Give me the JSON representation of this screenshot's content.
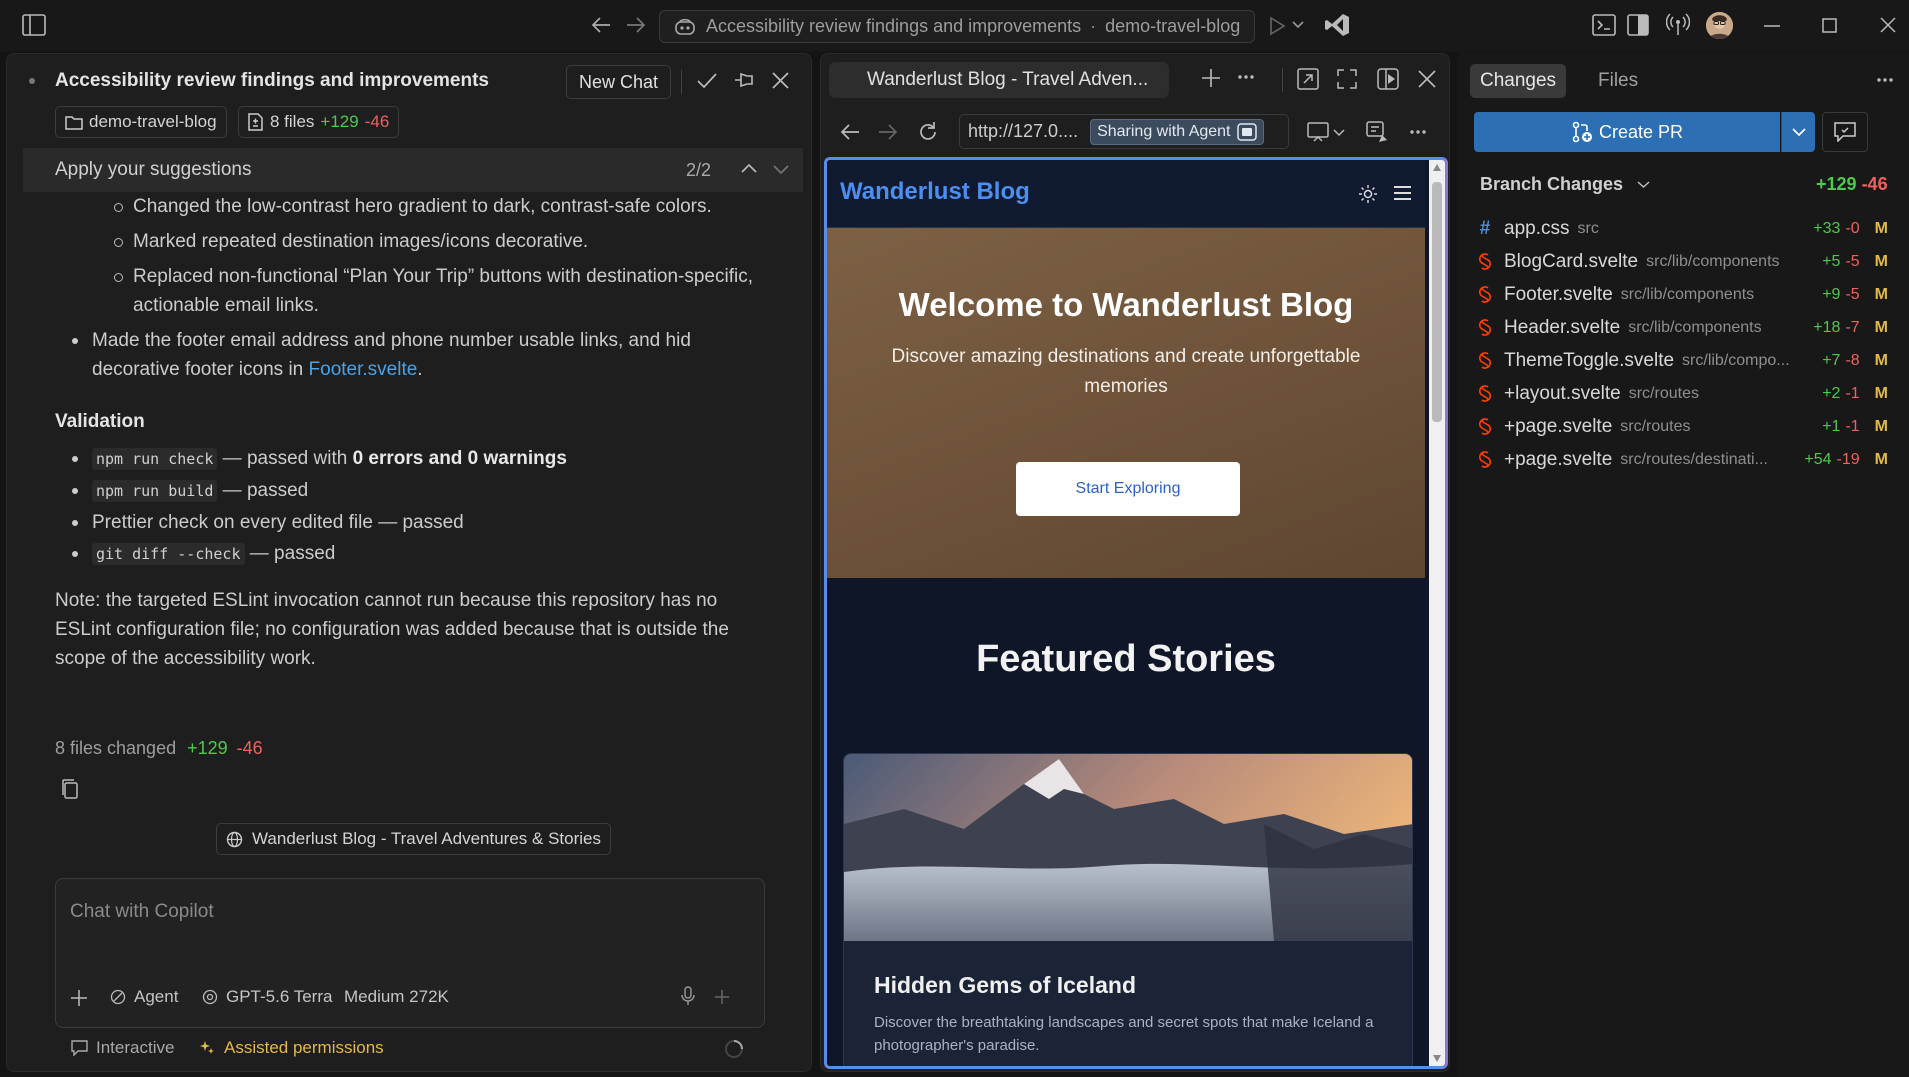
{
  "titlebar": {
    "command_center": {
      "title": "Accessibility review findings and improvements",
      "separator": "·",
      "repo": "demo-travel-blog"
    }
  },
  "chat": {
    "title": "Accessibility review findings and improvements",
    "new_chat_label": "New Chat",
    "repo_chip": "demo-travel-blog",
    "files_chip": {
      "label": "8 files",
      "added": "+129",
      "removed": "-46"
    },
    "suggestions": {
      "label": "Apply your suggestions",
      "counter": "2/2"
    },
    "message": {
      "sub_bullets": [
        "Changed the low-contrast hero gradient to dark, contrast-safe colors.",
        "Marked repeated destination images/icons decorative.",
        "Replaced non-functional “Plan Your Trip” buttons with destination-specific, actionable email links."
      ],
      "footer_bullet": {
        "text": "Made the footer email address and phone number usable links, and hid decorative footer icons in ",
        "link": "Footer.svelte",
        "end": "."
      },
      "validation_heading": "Validation",
      "validation": [
        {
          "code": "npm run check",
          "text": " — passed with ",
          "bold": "0 errors and 0 warnings"
        },
        {
          "code": "npm run build",
          "text": " — passed",
          "bold": ""
        },
        {
          "code": "",
          "text": "Prettier check on every edited file — passed",
          "bold": ""
        },
        {
          "code": "git diff --check",
          "text": " — passed",
          "bold": ""
        }
      ],
      "note": "Note: the targeted ESLint invocation cannot run because this repository has no ESLint configuration file; no configuration was added because that is outside the scope of the accessibility work."
    },
    "summary": {
      "label": "8 files changed",
      "added": "+129",
      "removed": "-46"
    },
    "page_chip": "Wanderlust Blog - Travel Adventures & Stories",
    "input": {
      "placeholder": "Chat with Copilot",
      "mode": "Agent",
      "model": "GPT-5.6 Terra",
      "context": "Medium 272K"
    },
    "footer": {
      "interactive": "Interactive",
      "permissions": "Assisted permissions"
    }
  },
  "browser": {
    "tab_title": "Wanderlust Blog - Travel Adven...",
    "url": "http://127.0....",
    "sharing_label": "Sharing with Agent",
    "site": {
      "brand": "Wanderlust Blog",
      "hero_title": "Welcome to Wanderlust Blog",
      "hero_subtitle": "Discover amazing destinations and create unforgettable memories",
      "cta": "Start Exploring",
      "section_title": "Featured Stories",
      "card_title": "Hidden Gems of Iceland",
      "card_text": "Discover the breathtaking landscapes and secret spots that make Iceland a photographer's paradise."
    }
  },
  "changes": {
    "tabs": [
      "Changes",
      "Files"
    ],
    "create_pr": "Create PR",
    "branch_label": "Branch Changes",
    "branch_added": "+129",
    "branch_removed": "-46",
    "files": [
      {
        "name": "app.css",
        "path": "src",
        "added": "+33",
        "removed": "-0",
        "status": "M",
        "icon": "hash-icon"
      },
      {
        "name": "BlogCard.svelte",
        "path": "src/lib/components",
        "added": "+5",
        "removed": "-5",
        "status": "M",
        "icon": "svelte-icon"
      },
      {
        "name": "Footer.svelte",
        "path": "src/lib/components",
        "added": "+9",
        "removed": "-5",
        "status": "M",
        "icon": "svelte-icon"
      },
      {
        "name": "Header.svelte",
        "path": "src/lib/components",
        "added": "+18",
        "removed": "-7",
        "status": "M",
        "icon": "svelte-icon"
      },
      {
        "name": "ThemeToggle.svelte",
        "path": "src/lib/compo...",
        "added": "+7",
        "removed": "-8",
        "status": "M",
        "icon": "svelte-icon"
      },
      {
        "name": "+layout.svelte",
        "path": "src/routes",
        "added": "+2",
        "removed": "-1",
        "status": "M",
        "icon": "svelte-icon"
      },
      {
        "name": "+page.svelte",
        "path": "src/routes",
        "added": "+1",
        "removed": "-1",
        "status": "M",
        "icon": "svelte-icon"
      },
      {
        "name": "+page.svelte",
        "path": "src/routes/destinati...",
        "added": "+54",
        "removed": "-19",
        "status": "M",
        "icon": "svelte-icon"
      }
    ]
  },
  "colors": {
    "accent": "#2c6fb5",
    "added": "#4ec94e",
    "removed": "#f0605d",
    "modified": "#e2b94a",
    "svelte": "#ff3e00",
    "link": "#4aa3e8"
  }
}
